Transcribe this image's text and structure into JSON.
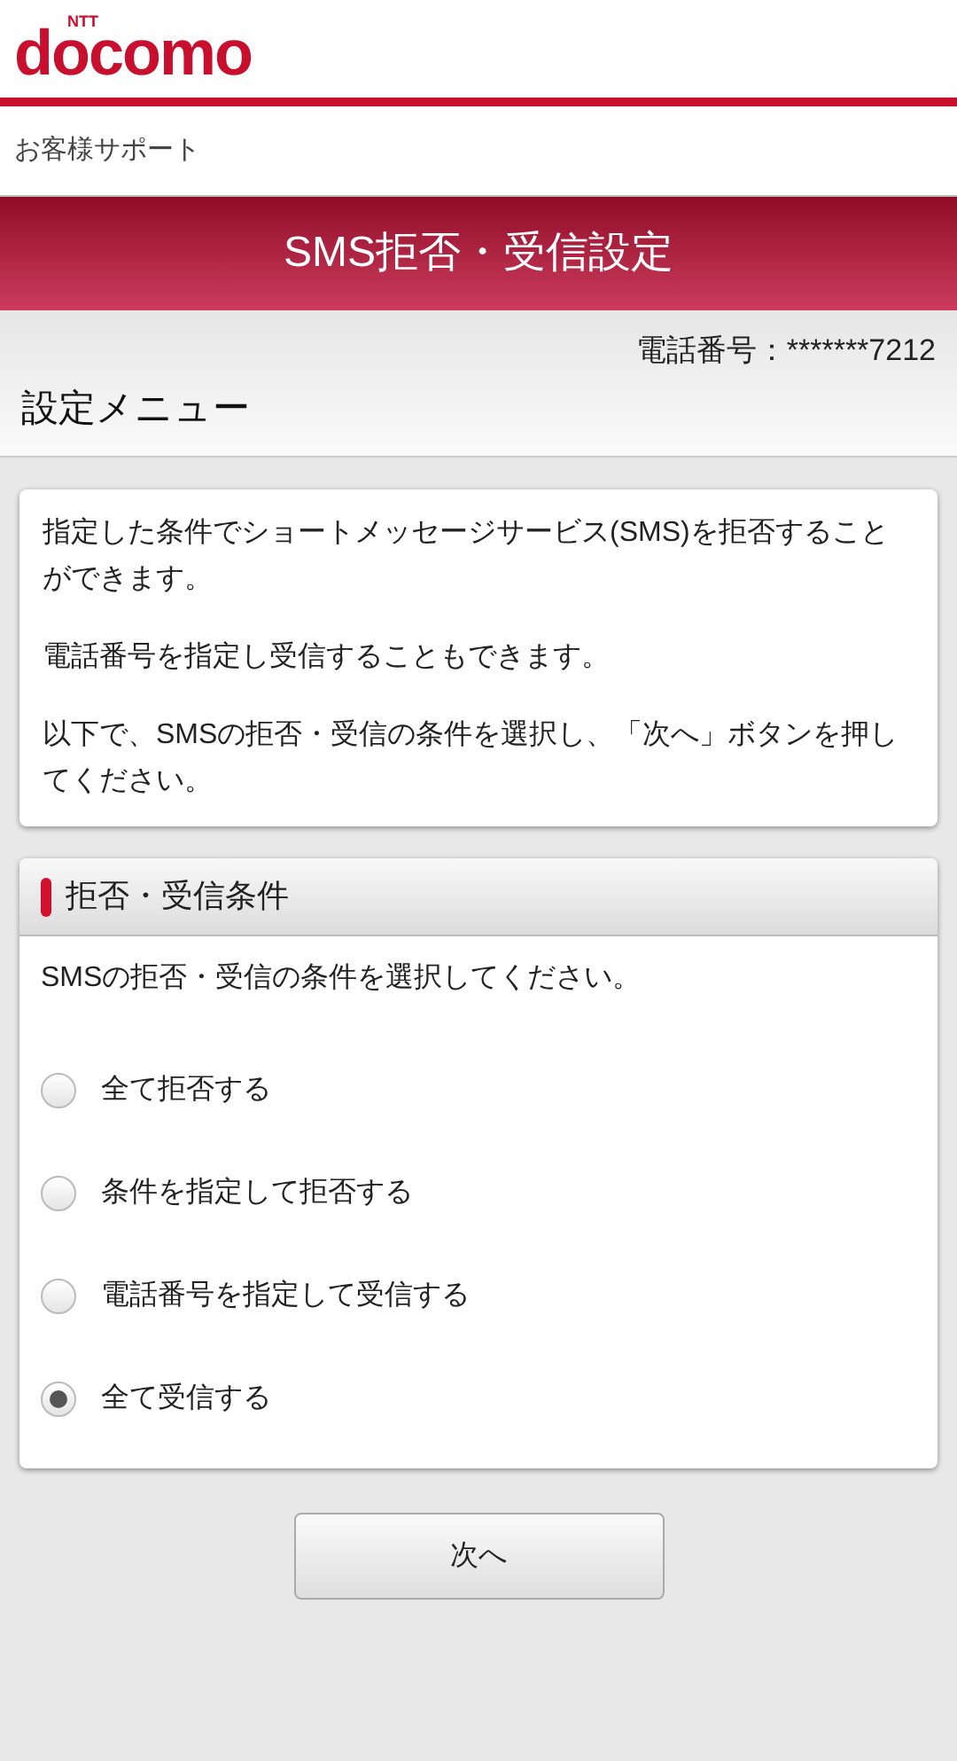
{
  "header": {
    "logo_small": "NTT",
    "logo": "docomo"
  },
  "breadcrumb": "お客様サポート",
  "title": "SMS拒否・受信設定",
  "phone_number": "電話番号：*******7212",
  "section_heading": "設定メニュー",
  "intro": [
    "指定した条件でショートメッセージサービス(SMS)を拒否することができます。",
    "電話番号を指定し受信することもできます。",
    "以下で、SMSの拒否・受信の条件を選択し、「次へ」ボタンを押してください。"
  ],
  "conditions": {
    "title": "拒否・受信条件",
    "instruction": "SMSの拒否・受信の条件を選択してください。",
    "options": [
      {
        "label": "全て拒否する",
        "selected": false
      },
      {
        "label": "条件を指定して拒否する",
        "selected": false
      },
      {
        "label": "電話番号を指定して受信する",
        "selected": false
      },
      {
        "label": "全て受信する",
        "selected": true
      }
    ]
  },
  "next_button": "次へ"
}
